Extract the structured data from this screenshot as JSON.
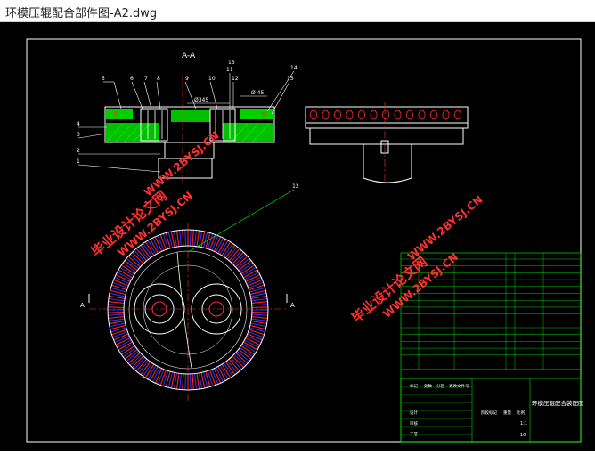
{
  "window": {
    "title": "环模压辊配合部件图-A2.dwg"
  },
  "drawing": {
    "section_label": "A-A",
    "view_marker_left": "A",
    "view_marker_right": "A",
    "dims": {
      "top": "Ø345",
      "right": "Ø 45"
    },
    "callouts": [
      "5",
      "6",
      "7",
      "8",
      "9",
      "10",
      "11",
      "12",
      "13",
      "14",
      "15",
      "4",
      "3",
      "2",
      "1",
      "12"
    ],
    "colors": {
      "outline": "#ffffff",
      "hatch": "#00e000",
      "ring_red": "#ff2020",
      "ring_blue": "#3030ff",
      "leader": "#00ff00"
    }
  },
  "watermark": {
    "cn": "毕业设计论文网",
    "url": "WWW.2BYSJ.CN",
    "color": "#ff3030"
  },
  "title_block": {
    "drawing_name": "环模压辊配合装配图",
    "labels": [
      "标记",
      "处数",
      "分区",
      "更改文件号",
      "签名",
      "年月日",
      "设计",
      "审核",
      "工艺",
      "批准",
      "阶段标记",
      "重量",
      "比例"
    ],
    "scale": "1:1",
    "sheet": "10"
  }
}
